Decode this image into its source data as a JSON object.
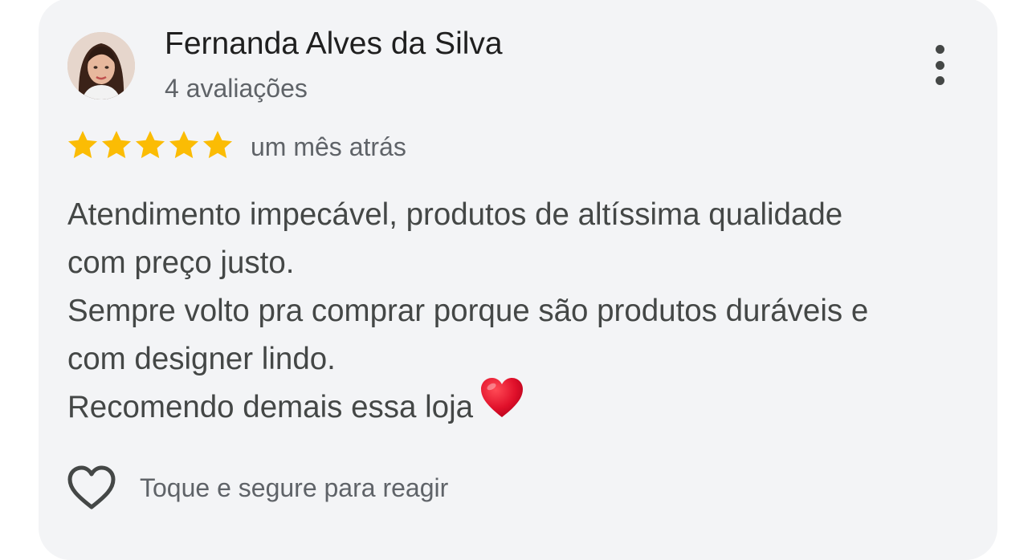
{
  "review": {
    "author_name": "Fernanda Alves da Silva",
    "author_reviews": "4 avaliações",
    "rating": 5,
    "rating_max": 5,
    "time_ago": "um mês atrás",
    "text_lines": [
      "Atendimento impecável, produtos de altíssima qualidade",
      "com preço justo.",
      "Sempre volto pra comprar porque são produtos duráveis e",
      "com designer lindo.",
      "Recomendo demais essa loja"
    ],
    "react_label": "Toque e segure para reagir"
  },
  "icons": {
    "more": "more-vert-icon",
    "star": "star-icon",
    "emoji": "red-heart-emoji",
    "react": "heart-outline-icon"
  },
  "colors": {
    "card_bg": "#f3f4f6",
    "star": "#fbbc04",
    "emoji_heart": "#e0102a",
    "secondary_text": "#5f6368"
  }
}
